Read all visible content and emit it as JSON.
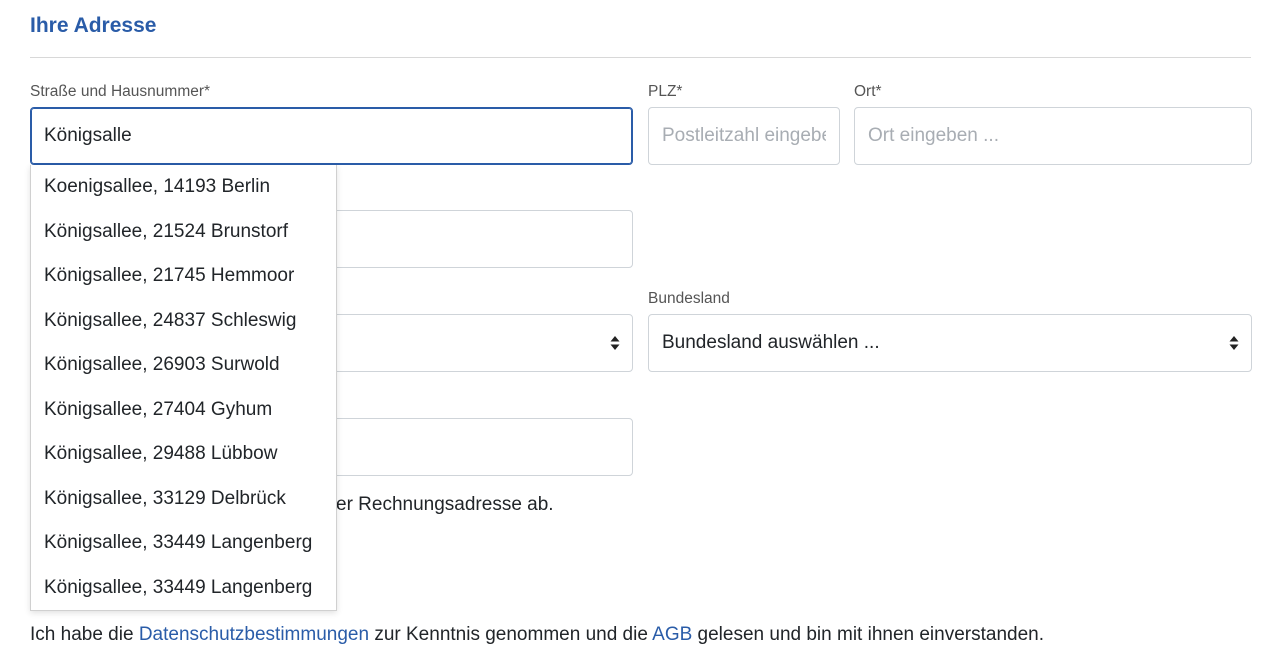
{
  "section": {
    "title": "Ihre Adresse"
  },
  "street": {
    "label": "Straße und Hausnummer*",
    "value": "Königsalle"
  },
  "zip": {
    "label": "PLZ*",
    "placeholder": "Postleitzahl eingeben ..."
  },
  "city": {
    "label": "Ort*",
    "placeholder": "Ort eingeben ..."
  },
  "state": {
    "label": "Bundesland",
    "selected": "Bundesland auswählen ..."
  },
  "autocomplete": {
    "items": [
      "Koenigsallee, 14193 Berlin",
      "Königsallee, 21524 Brunstorf",
      "Königsallee, 21745 Hemmoor",
      "Königsallee, 24837 Schleswig",
      "Königsallee, 26903 Surwold",
      "Königsallee, 27404 Gyhum",
      "Königsallee, 29488 Lübbow",
      "Königsallee, 33129 Delbrück",
      "Königsallee, 33449 Langenberg",
      "Königsallee, 33449 Langenberg"
    ]
  },
  "billing_note": {
    "partial": "er Rechnungsadresse ab."
  },
  "consent": {
    "prefix": "Ich habe die ",
    "privacy_link": "Datenschutzbestimmungen",
    "middle": " zur Kenntnis genommen und die ",
    "agb_link": "AGB",
    "suffix": " gelesen und bin mit ihnen einverstanden."
  }
}
